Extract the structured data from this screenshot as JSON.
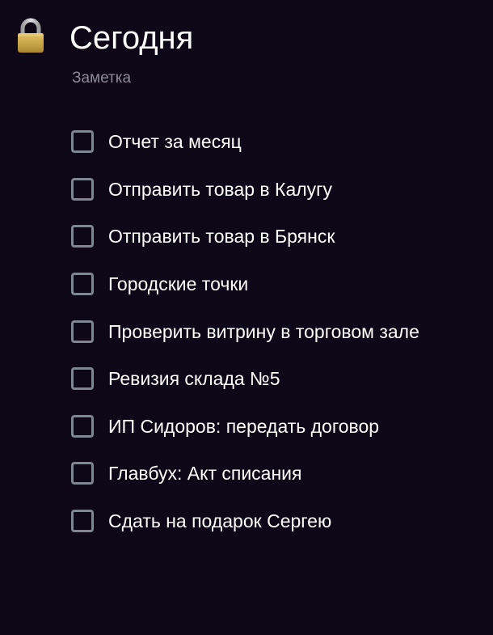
{
  "header": {
    "icon": "lock-icon",
    "title": "Сегодня",
    "subtitle": "Заметка"
  },
  "checklist": {
    "items": [
      {
        "label": "Отчет за месяц",
        "checked": false
      },
      {
        "label": "Отправить товар в Калугу",
        "checked": false
      },
      {
        "label": "Отправить товар в Брянск",
        "checked": false
      },
      {
        "label": "Городские точки",
        "checked": false
      },
      {
        "label": "Проверить витрину в торговом зале",
        "checked": false
      },
      {
        "label": "Ревизия склада №5",
        "checked": false
      },
      {
        "label": "ИП Сидоров: передать договор",
        "checked": false
      },
      {
        "label": "Главбух: Акт списания",
        "checked": false
      },
      {
        "label": "Сдать на подарок Сергею",
        "checked": false
      }
    ]
  },
  "colors": {
    "background": "#0d0717",
    "text": "#ffffff",
    "subtitle": "#8b8a98",
    "checkbox_border": "#7e8593",
    "lock_body": "#c9a449",
    "lock_shackle": "#c6c6c6"
  }
}
